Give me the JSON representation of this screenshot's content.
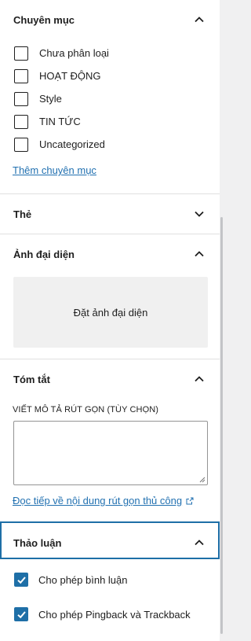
{
  "categories_panel": {
    "title": "Chuyên mục",
    "items": [
      {
        "label": "Chưa phân loại",
        "checked": false
      },
      {
        "label": "HOẠT ĐỘNG",
        "checked": false
      },
      {
        "label": "Style",
        "checked": false
      },
      {
        "label": "TIN TỨC",
        "checked": false
      },
      {
        "label": "Uncategorized",
        "checked": false
      }
    ],
    "add_link": "Thêm chuyên mục"
  },
  "tags_panel": {
    "title": "Thẻ"
  },
  "featured_image_panel": {
    "title": "Ảnh đại diện",
    "button_label": "Đặt ảnh đại diện"
  },
  "excerpt_panel": {
    "title": "Tóm tắt",
    "field_label": "VIẾT MÔ TẢ RÚT GỌN (TÙY CHỌN)",
    "value": "",
    "learn_more_link": "Đọc tiếp về nội dung rút gọn thủ công"
  },
  "discussion_panel": {
    "title": "Thảo luận",
    "options": [
      {
        "label": "Cho phép bình luận",
        "checked": true
      },
      {
        "label": "Cho phép Pingback và Trackback",
        "checked": true
      }
    ]
  },
  "colors": {
    "accent": "#1e6fa7",
    "link": "#2271b1",
    "border": "#e0e0e0"
  }
}
